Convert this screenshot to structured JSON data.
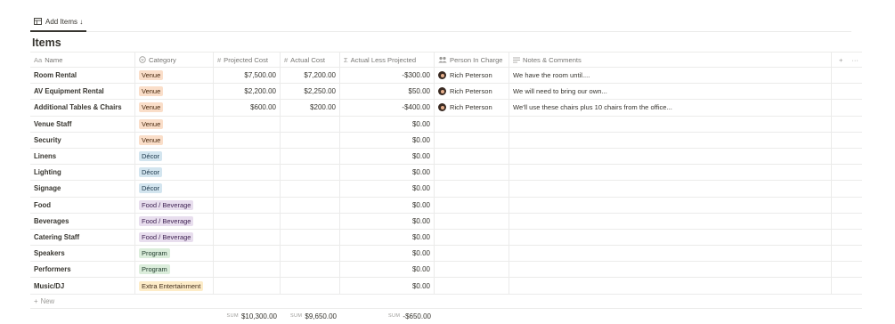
{
  "view_tab": {
    "label": "Add Items ↓",
    "icon": "table-icon"
  },
  "database_title": "Items",
  "columns": {
    "name": {
      "label": "Name",
      "icon": "Aa"
    },
    "category": {
      "label": "Category",
      "icon": "select-icon"
    },
    "projected": {
      "label": "Projected Cost",
      "icon": "#"
    },
    "actual": {
      "label": "Actual Cost",
      "icon": "#"
    },
    "less": {
      "label": "Actual Less Projected",
      "icon": "Σ"
    },
    "person": {
      "label": "Person In Charge",
      "icon": "people-icon"
    },
    "notes": {
      "label": "Notes & Comments",
      "icon": "text-lines-icon"
    },
    "add": "+",
    "more": "···"
  },
  "rows": [
    {
      "name": "Room Rental",
      "category": "Venue",
      "cat_class": "venue",
      "projected": "$7,500.00",
      "actual": "$7,200.00",
      "less": "-$300.00",
      "person": "Rich Peterson",
      "notes": "We have the room until...."
    },
    {
      "name": "AV Equipment Rental",
      "category": "Venue",
      "cat_class": "venue",
      "projected": "$2,200.00",
      "actual": "$2,250.00",
      "less": "$50.00",
      "person": "Rich Peterson",
      "notes": "We will need to bring our own..."
    },
    {
      "name": "Additional Tables & Chairs",
      "category": "Venue",
      "cat_class": "venue",
      "projected": "$600.00",
      "actual": "$200.00",
      "less": "-$400.00",
      "person": "Rich Peterson",
      "notes": "We'll use these chairs plus 10 chairs from the office..."
    },
    {
      "name": "Venue Staff",
      "category": "Venue",
      "cat_class": "venue",
      "projected": "",
      "actual": "",
      "less": "$0.00",
      "person": "",
      "notes": ""
    },
    {
      "name": "Security",
      "category": "Venue",
      "cat_class": "venue",
      "projected": "",
      "actual": "",
      "less": "$0.00",
      "person": "",
      "notes": ""
    },
    {
      "name": "Linens",
      "category": "Décor",
      "cat_class": "decor",
      "projected": "",
      "actual": "",
      "less": "$0.00",
      "person": "",
      "notes": ""
    },
    {
      "name": "Lighting",
      "category": "Décor",
      "cat_class": "decor",
      "projected": "",
      "actual": "",
      "less": "$0.00",
      "person": "",
      "notes": ""
    },
    {
      "name": "Signage",
      "category": "Décor",
      "cat_class": "decor",
      "projected": "",
      "actual": "",
      "less": "$0.00",
      "person": "",
      "notes": ""
    },
    {
      "name": "Food",
      "category": "Food / Beverage",
      "cat_class": "food",
      "projected": "",
      "actual": "",
      "less": "$0.00",
      "person": "",
      "notes": ""
    },
    {
      "name": "Beverages",
      "category": "Food / Beverage",
      "cat_class": "food",
      "projected": "",
      "actual": "",
      "less": "$0.00",
      "person": "",
      "notes": ""
    },
    {
      "name": "Catering Staff",
      "category": "Food / Beverage",
      "cat_class": "food",
      "projected": "",
      "actual": "",
      "less": "$0.00",
      "person": "",
      "notes": ""
    },
    {
      "name": "Speakers",
      "category": "Program",
      "cat_class": "program",
      "projected": "",
      "actual": "",
      "less": "$0.00",
      "person": "",
      "notes": ""
    },
    {
      "name": "Performers",
      "category": "Program",
      "cat_class": "program",
      "projected": "",
      "actual": "",
      "less": "$0.00",
      "person": "",
      "notes": ""
    },
    {
      "name": "Music/DJ",
      "category": "Extra Entertainment",
      "cat_class": "extra",
      "projected": "",
      "actual": "",
      "less": "$0.00",
      "person": "",
      "notes": ""
    }
  ],
  "new_row_label": "New",
  "sums": {
    "label": "SUM",
    "projected": "$10,300.00",
    "actual": "$9,650.00",
    "less": "-$650.00"
  }
}
